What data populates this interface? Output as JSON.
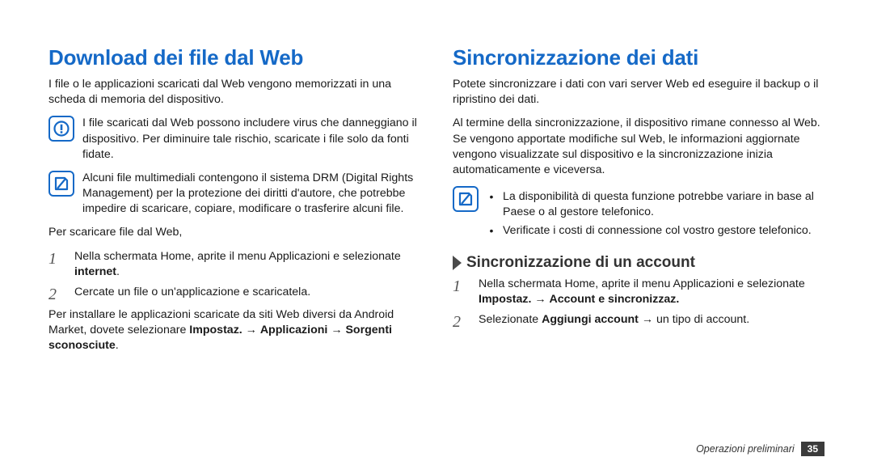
{
  "left": {
    "heading": "Download dei file dal Web",
    "intro": "I file o le applicazioni scaricati dal Web vengono memorizzati in una scheda di memoria del dispositivo.",
    "warn": "I file scaricati dal Web possono includere virus che danneggiano il dispositivo. Per diminuire tale rischio, scaricate i file solo da fonti fidate.",
    "note": "Alcuni file multimediali contengono il sistema DRM (Digital Rights Management) per la protezione dei diritti d'autore, che potrebbe impedire di scaricare, copiare, modificare o trasferire alcuni file.",
    "lead": "Per scaricare file dal Web,",
    "step1_a": "Nella schermata Home, aprite il menu Applicazioni e selezionate ",
    "step1_b": "internet",
    "step1_c": ".",
    "step2": "Cercate un file o un'applicazione e scaricatela.",
    "tail_a": "Per installare le applicazioni scaricate da siti Web diversi da Android Market, dovete selezionare ",
    "tail_b": "Impostaz.",
    "tail_arrow1": " → ",
    "tail_c": "Applicazioni",
    "tail_arrow2": " → ",
    "tail_d": "Sorgenti sconosciute",
    "tail_e": "."
  },
  "right": {
    "heading": "Sincronizzazione dei dati",
    "p1": "Potete sincronizzare i dati con vari server Web ed eseguire il backup o il ripristino dei dati.",
    "p2": "Al termine della sincronizzazione, il dispositivo rimane connesso al Web. Se vengono apportate modifiche sul Web, le informazioni aggiornate vengono visualizzate sul dispositivo e la sincronizzazione inizia automaticamente e viceversa.",
    "note_b1": "La disponibilità di questa funzione potrebbe variare in base al Paese o al gestore telefonico.",
    "note_b2": "Verificate i costi di connessione col vostro gestore telefonico.",
    "sub": "Sincronizzazione di un account",
    "s1_a": "Nella schermata Home, aprite il menu Applicazioni e selezionate ",
    "s1_b": "Impostaz.",
    "s1_arrow": " → ",
    "s1_c": "Account e sincronizzaz.",
    "s2_a": "Selezionate ",
    "s2_b": "Aggiungi account",
    "s2_c": " → un tipo di account."
  },
  "footer": {
    "section": "Operazioni preliminari",
    "page": "35"
  },
  "steps": {
    "n1": "1",
    "n2": "2"
  }
}
